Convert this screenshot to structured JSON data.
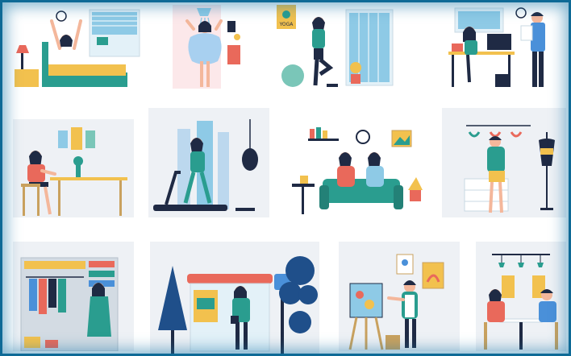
{
  "image": {
    "scenes": [
      {
        "name": "waking-up-scene"
      },
      {
        "name": "shower-scene"
      },
      {
        "name": "yoga-scene"
      },
      {
        "name": "office-scene"
      },
      {
        "name": "cafe-table-scene"
      },
      {
        "name": "treadmill-gym-scene"
      },
      {
        "name": "living-room-sofa-scene"
      },
      {
        "name": "lingerie-shop-scene"
      },
      {
        "name": "wardrobe-scene"
      },
      {
        "name": "bus-stop-scene"
      },
      {
        "name": "painting-easel-scene"
      },
      {
        "name": "restaurant-date-scene"
      }
    ],
    "poster_text": "YOGA",
    "colors": {
      "frame": "#0e6a96",
      "panel_bg": "#eef1f5",
      "skin": "#f4b79b",
      "hair": "#1f2a44",
      "teal": "#2a9d8f",
      "coral": "#e9695b",
      "yellow": "#f2c14e",
      "navy": "#1f2a44",
      "blue": "#4a90d9"
    }
  }
}
